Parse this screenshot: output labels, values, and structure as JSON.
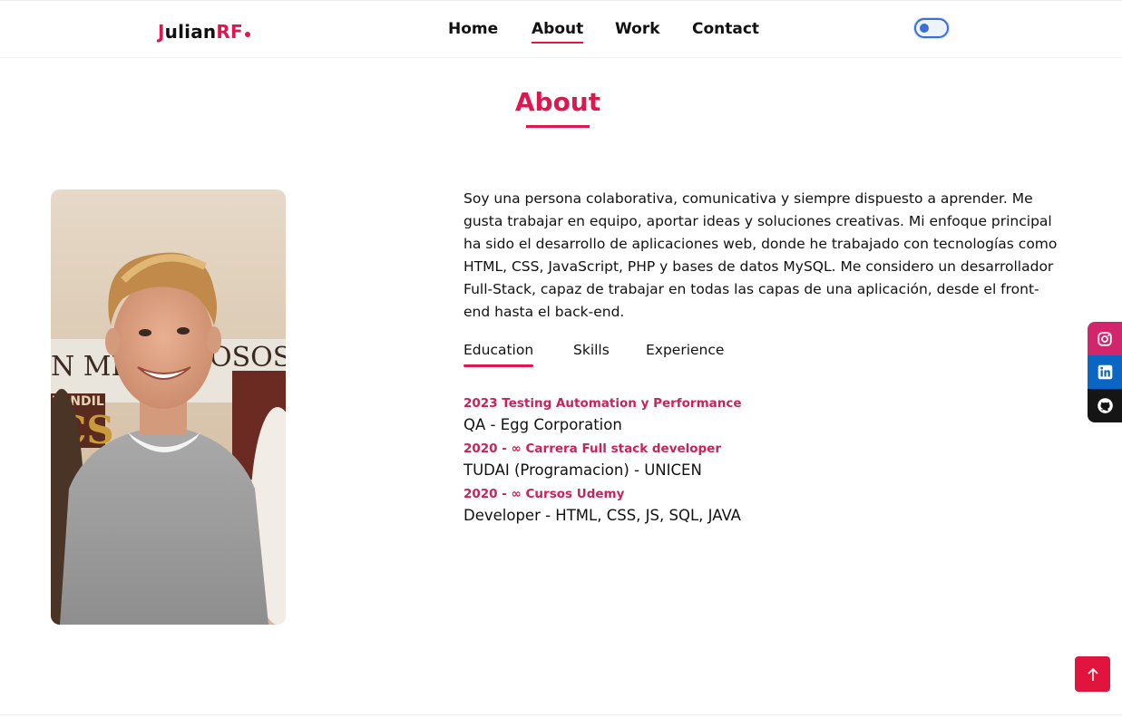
{
  "header": {
    "logo": {
      "part1": "J",
      "part2": "ulian",
      "part3": "RF"
    },
    "nav": [
      {
        "label": "Home",
        "active": false
      },
      {
        "label": "About",
        "active": true
      },
      {
        "label": "Work",
        "active": false
      },
      {
        "label": "Contact",
        "active": false
      }
    ],
    "theme_toggle_icon": "toggle-switch"
  },
  "about": {
    "title": "About",
    "description": "Soy una persona colaborativa, comunicativa y siempre dispuesto a aprender. Me gusta trabajar en equipo, aportar ideas y soluciones creativas. Mi enfoque principal ha sido el desarrollo de aplicaciones web, donde he trabajado con tecnologías como HTML, CSS, JavaScript, PHP y bases de datos MySQL. Me considero un desarrollador Full-Stack, capaz de trabajar en todas las capas de una aplicación, desde el front-end hasta el back-end.",
    "tabs": [
      {
        "label": "Education",
        "active": true
      },
      {
        "label": "Skills",
        "active": false
      },
      {
        "label": "Experience",
        "active": false
      }
    ],
    "education": [
      {
        "date": "2023 Testing Automation y Performance",
        "description": "QA - Egg Corporation"
      },
      {
        "date": "2020 - ∞ Carrera Full stack developer",
        "description": "TUDAI (Programacion) - UNICEN"
      },
      {
        "date": "2020 - ∞ Cursos Udemy",
        "description": "Developer - HTML, CSS, JS, SQL, JAVA"
      }
    ]
  },
  "social": [
    {
      "name": "instagram",
      "icon": "instagram-icon",
      "color": "#d3246e"
    },
    {
      "name": "linkedin",
      "icon": "linkedin-icon",
      "color": "#0a66c2"
    },
    {
      "name": "github",
      "icon": "github-icon",
      "color": "#151515"
    }
  ],
  "scroll_top": {
    "icon": "arrow-up-icon",
    "color": "#e0143c"
  },
  "colors": {
    "accent": "#e0174f",
    "date": "#c8235a"
  }
}
